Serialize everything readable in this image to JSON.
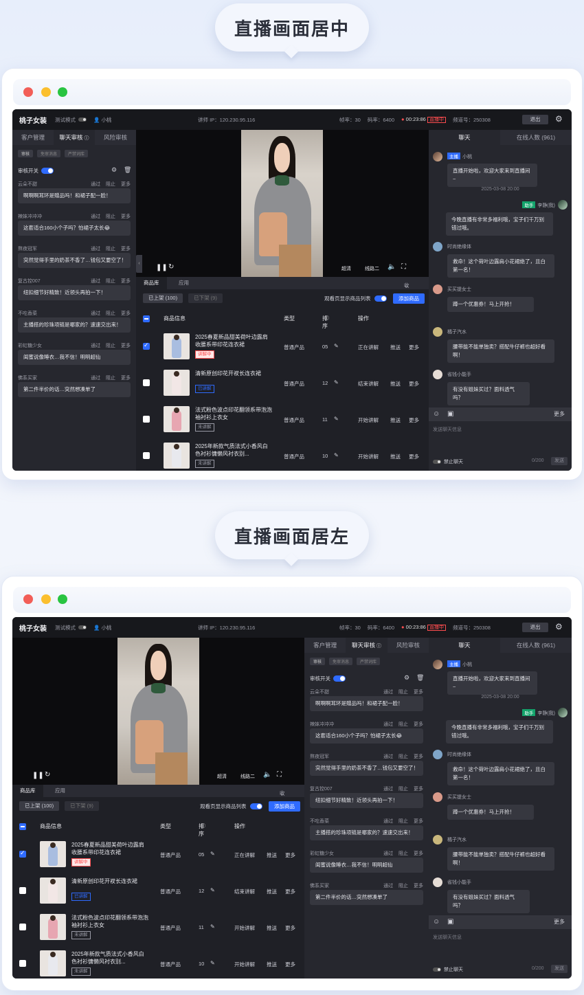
{
  "sections": [
    {
      "heading": "直播画面居中"
    },
    {
      "heading": "直播画面居左"
    }
  ],
  "colors": {
    "accent": "#2f6bff",
    "live": "#ff4d4f",
    "window_red": "#f25e57",
    "window_yellow": "#fbbf2e",
    "window_green": "#29c441"
  },
  "topbar": {
    "brand": "桃子女装",
    "mode_label": "测试模式",
    "user": "小桃",
    "ip": "讲师 IP：120.230.95.116",
    "fps": "帧率：30",
    "bitrate": "码率：6400",
    "timer": "00:23:86",
    "live_badge": "直播中",
    "channel": "频道号：250308",
    "exit_label": "退出"
  },
  "review": {
    "tabs": [
      "客户管理",
      "聊天审核",
      "风险审核"
    ],
    "subtabs": [
      "审核",
      "免审消息",
      "严禁词库"
    ],
    "switch_label": "审核开关",
    "ops": "通过 阻止 更多",
    "messages": [
      {
        "name": "云朵不甜",
        "text": "啊啊啊耳环是赠品吗！和裙子配一脸！"
      },
      {
        "name": "辣妹冲冲冲",
        "text": "这套适合160小个子吗？怕裙子太长😂"
      },
      {
        "name": "熬夜冠军",
        "text": "突然觉得手里的奶茶不香了…钱包又要空了！"
      },
      {
        "name": "复古控007",
        "text": "纽扣细节好精致！近领头再拍一下！"
      },
      {
        "name": "不吃香菜",
        "text": "主播搭的珍珠项链是哪家的？速速交出来！"
      },
      {
        "name": "彩虹糖少女",
        "text": "闺蜜说像睡衣…我不信！明明超仙"
      },
      {
        "name": "佛系买家",
        "text": "第二件半价的话…突然想凑单了"
      }
    ]
  },
  "video": {
    "quality": "超清",
    "line": "线路二"
  },
  "goods": {
    "tabs": [
      "商品库",
      "应用"
    ],
    "collapse_label": "收起",
    "filter_on": "已上架 (100)",
    "filter_off": "已下架 (9)",
    "show_list_label": "观看页显示商品列表",
    "add_label": "添加商品",
    "headers": {
      "info": "商品信息",
      "type": "类型",
      "sort": "排序",
      "ops": "操作"
    },
    "rows": [
      {
        "name": "2025春夏新品甜美荷叶边露肩收腰系带印花连衣裙",
        "tag": "讲解中",
        "type": "普通产品",
        "sort": "05",
        "action": "正在讲解",
        "push": "推送",
        "more": "更多",
        "checked": true
      },
      {
        "name": "清新原创印花开衩长连衣裙",
        "tag": "已讲解",
        "type": "普通产品",
        "sort": "12",
        "action": "结束讲解",
        "push": "推送",
        "more": "更多",
        "checked": false
      },
      {
        "name": "法式粉色波点印花翻领系带泡泡袖衬衫上衣女",
        "tag": "未讲解",
        "type": "普通产品",
        "sort": "11",
        "action": "开始讲解",
        "push": "推送",
        "more": "更多",
        "checked": false
      },
      {
        "name": "2025年新款气质法式小香风白色衬衫慵懒风衬衣别...",
        "tag": "未讲解",
        "type": "普通产品",
        "sort": "10",
        "action": "开始讲解",
        "push": "推送",
        "more": "更多",
        "checked": false
      }
    ]
  },
  "chat": {
    "tabs": [
      "聊天",
      "在线人数 (961)"
    ],
    "host_role": "主播",
    "host_name": "小桃",
    "host_msg": "直播开始啦，欢迎大家来到直播间~",
    "time": "2025-03-08 20:00",
    "assist_role": "助手",
    "assist_name": "李静(我)",
    "assist_msg": "今晚直播有非常多福利哦，宝子们千万别错过哦。",
    "others": [
      {
        "name": "时尚绝缘体",
        "msg": "救命！这个荷叶边露肩小花裙绝了，且白第一名！"
      },
      {
        "name": "买买提女士",
        "msg": "蹲一个优惠券！马上开抢！"
      },
      {
        "name": "橘子汽水",
        "msg": "腰带能不能单独卖？搭配牛仔裤也超好看啊！"
      },
      {
        "name": "省钱小能手",
        "msg": "有没有姐妹买过？面料透气吗？"
      }
    ],
    "more_label": "更多",
    "placeholder": "发送聊天信息",
    "ban_label": "禁止聊天",
    "count": "0/200",
    "send_label": "发送"
  }
}
